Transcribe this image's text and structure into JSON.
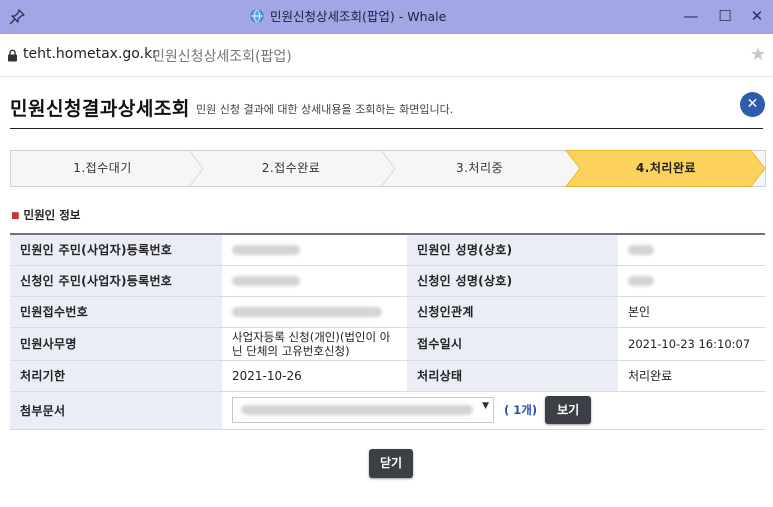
{
  "window": {
    "title": "민원신청상세조회(팝업) - Whale",
    "controls": {
      "minimize": "—",
      "maximize": "☐",
      "close": "✕"
    }
  },
  "address": {
    "host": "teht.hometax.go.kr",
    "page_title": "민원신청상세조회(팝업)",
    "bookmark_icon": "★"
  },
  "page": {
    "title": "민원신청결과상세조회",
    "description": "민원 신청 결과에 대한 상세내용을 조회하는 화면입니다.",
    "close_icon": "✕"
  },
  "steps": [
    {
      "label": "1.접수대기",
      "active": false
    },
    {
      "label": "2.접수완료",
      "active": false
    },
    {
      "label": "3.처리중",
      "active": false
    },
    {
      "label": "4.처리완료",
      "active": true
    }
  ],
  "section": {
    "title": "민원인 정보"
  },
  "table": {
    "rows": [
      {
        "label1": "민원인 주민(사업자)등록번호",
        "value1": "",
        "label2": "민원인 성명(상호)",
        "value2": ""
      },
      {
        "label1": "신청인 주민(사업자)등록번호",
        "value1": "",
        "label2": "신청인 성명(상호)",
        "value2": ""
      },
      {
        "label1": "민원접수번호",
        "value1": "",
        "label2": "신청인관계",
        "value2": "본인"
      },
      {
        "label1": "민원사무명",
        "value1": "사업자등록 신청(개인)(법인이 아닌 단체의 고유번호신청)",
        "label2": "접수일시",
        "value2": "2021-10-23 16:10:07"
      },
      {
        "label1": "처리기한",
        "value1": "2021-10-26",
        "label2": "처리상태",
        "value2": "처리완료"
      }
    ],
    "attachment": {
      "label": "첨부문서",
      "count": "( 1개)",
      "view_button": "보기"
    }
  },
  "footer": {
    "close_button": "닫기"
  },
  "colors": {
    "titlebar": "#a3a6e6",
    "active_step": "#fbd35c",
    "label_bg": "#eaedf5",
    "accent": "#2e5baa"
  }
}
